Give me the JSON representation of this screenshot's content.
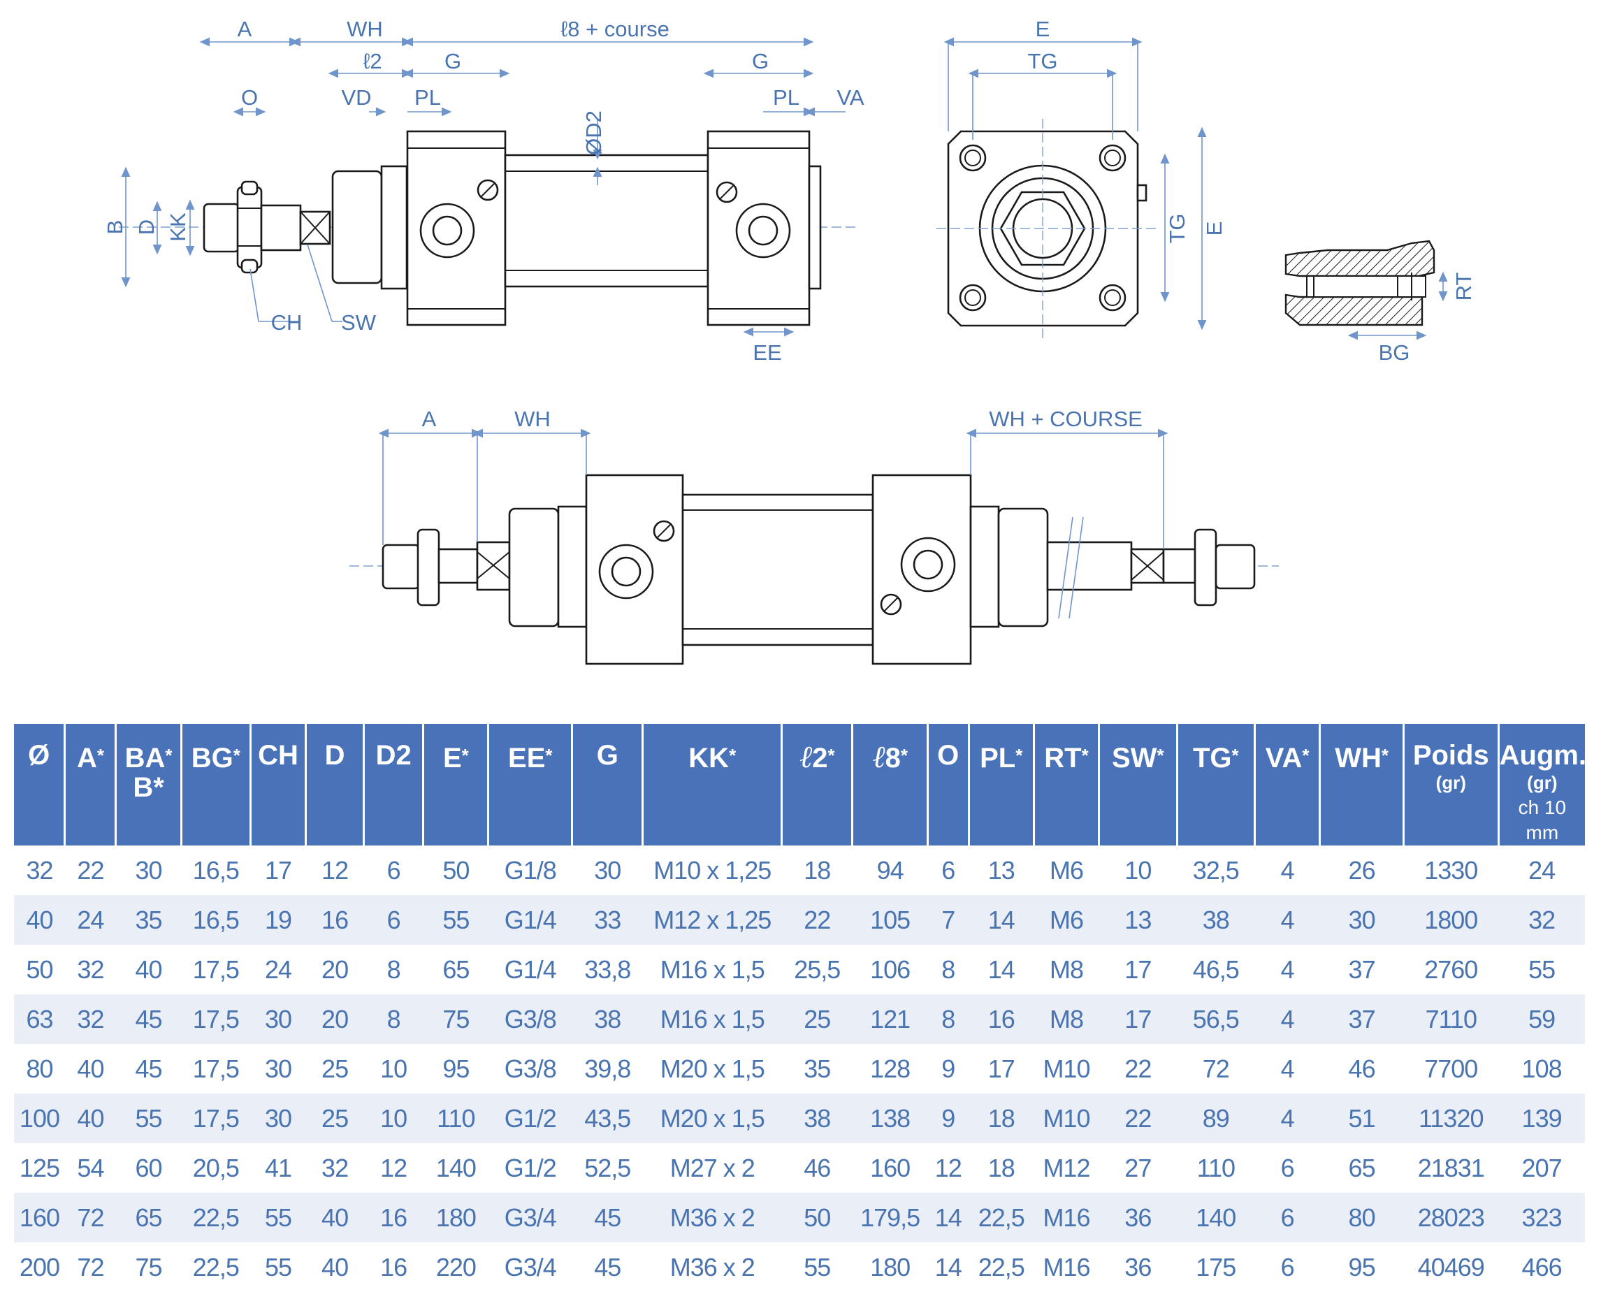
{
  "drawing_labels": {
    "front": {
      "A": "A",
      "WH": "WH",
      "l8_course": "ℓ8 + course",
      "l2": "ℓ2",
      "G_left": "G",
      "G_right": "G",
      "O": "O",
      "VD": "VD",
      "PL_left": "PL",
      "PL_right": "PL",
      "VA": "VA",
      "D2": "ØD2",
      "B": "B",
      "D": "D",
      "KK": "KK",
      "CH": "CH",
      "SW": "SW",
      "EE": "EE"
    },
    "end_view": {
      "E_top": "E",
      "TG_top": "TG",
      "TG_side": "TG",
      "E_side": "E"
    },
    "section": {
      "RT": "RT",
      "BG": "BG"
    },
    "double_rod": {
      "A": "A",
      "WH": "WH",
      "WH_course": "WH + COURSE"
    }
  },
  "table": {
    "headers": [
      {
        "main": "Ø"
      },
      {
        "main": "A",
        "star": "*"
      },
      {
        "main": "BA",
        "star": "*",
        "line2": "B*"
      },
      {
        "main": "BG",
        "star": "*"
      },
      {
        "main": "CH"
      },
      {
        "main": "D"
      },
      {
        "main": "D2"
      },
      {
        "main": "E",
        "star": "*"
      },
      {
        "main": "EE",
        "star": "*"
      },
      {
        "main": "G"
      },
      {
        "main": "KK",
        "star": "*"
      },
      {
        "sym": "ℓ",
        "main": "2",
        "star": "*"
      },
      {
        "sym": "ℓ",
        "main": "8",
        "star": "*"
      },
      {
        "main": "O"
      },
      {
        "main": "PL",
        "star": "*"
      },
      {
        "main": "RT",
        "star": "*"
      },
      {
        "main": "SW",
        "star": "*"
      },
      {
        "main": "TG",
        "star": "*"
      },
      {
        "main": "VA",
        "star": "*"
      },
      {
        "main": "WH",
        "star": "*"
      },
      {
        "main": "Poids",
        "sub": "(gr)"
      },
      {
        "main": "Augm.",
        "sub": "(gr)",
        "note": "ch 10 mm"
      }
    ],
    "rows": [
      [
        "32",
        "22",
        "30",
        "16,5",
        "17",
        "12",
        "6",
        "50",
        "G1/8",
        "30",
        "M10 x 1,25",
        "18",
        "94",
        "6",
        "13",
        "M6",
        "10",
        "32,5",
        "4",
        "26",
        "1330",
        "24"
      ],
      [
        "40",
        "24",
        "35",
        "16,5",
        "19",
        "16",
        "6",
        "55",
        "G1/4",
        "33",
        "M12 x 1,25",
        "22",
        "105",
        "7",
        "14",
        "M6",
        "13",
        "38",
        "4",
        "30",
        "1800",
        "32"
      ],
      [
        "50",
        "32",
        "40",
        "17,5",
        "24",
        "20",
        "8",
        "65",
        "G1/4",
        "33,8",
        "M16 x 1,5",
        "25,5",
        "106",
        "8",
        "14",
        "M8",
        "17",
        "46,5",
        "4",
        "37",
        "2760",
        "55"
      ],
      [
        "63",
        "32",
        "45",
        "17,5",
        "30",
        "20",
        "8",
        "75",
        "G3/8",
        "38",
        "M16 x 1,5",
        "25",
        "121",
        "8",
        "16",
        "M8",
        "17",
        "56,5",
        "4",
        "37",
        "7110",
        "59"
      ],
      [
        "80",
        "40",
        "45",
        "17,5",
        "30",
        "25",
        "10",
        "95",
        "G3/8",
        "39,8",
        "M20 x 1,5",
        "35",
        "128",
        "9",
        "17",
        "M10",
        "22",
        "72",
        "4",
        "46",
        "7700",
        "108"
      ],
      [
        "100",
        "40",
        "55",
        "17,5",
        "30",
        "25",
        "10",
        "110",
        "G1/2",
        "43,5",
        "M20 x 1,5",
        "38",
        "138",
        "9",
        "18",
        "M10",
        "22",
        "89",
        "4",
        "51",
        "11320",
        "139"
      ],
      [
        "125",
        "54",
        "60",
        "20,5",
        "41",
        "32",
        "12",
        "140",
        "G1/2",
        "52,5",
        "M27 x 2",
        "46",
        "160",
        "12",
        "18",
        "M12",
        "27",
        "110",
        "6",
        "65",
        "21831",
        "207"
      ],
      [
        "160",
        "72",
        "65",
        "22,5",
        "55",
        "40",
        "16",
        "180",
        "G3/4",
        "45",
        "M36 x 2",
        "50",
        "179,5",
        "14",
        "22,5",
        "M16",
        "36",
        "140",
        "6",
        "80",
        "28023",
        "323"
      ],
      [
        "200",
        "72",
        "75",
        "22,5",
        "55",
        "40",
        "16",
        "220",
        "G3/4",
        "45",
        "M36 x 2",
        "55",
        "180",
        "14",
        "22,5",
        "M16",
        "36",
        "175",
        "6",
        "95",
        "40469",
        "466"
      ]
    ]
  },
  "colors": {
    "header_bg": "#4a72b9",
    "text_blue": "#4a74b0",
    "row_stripe": "#eaeef7"
  }
}
